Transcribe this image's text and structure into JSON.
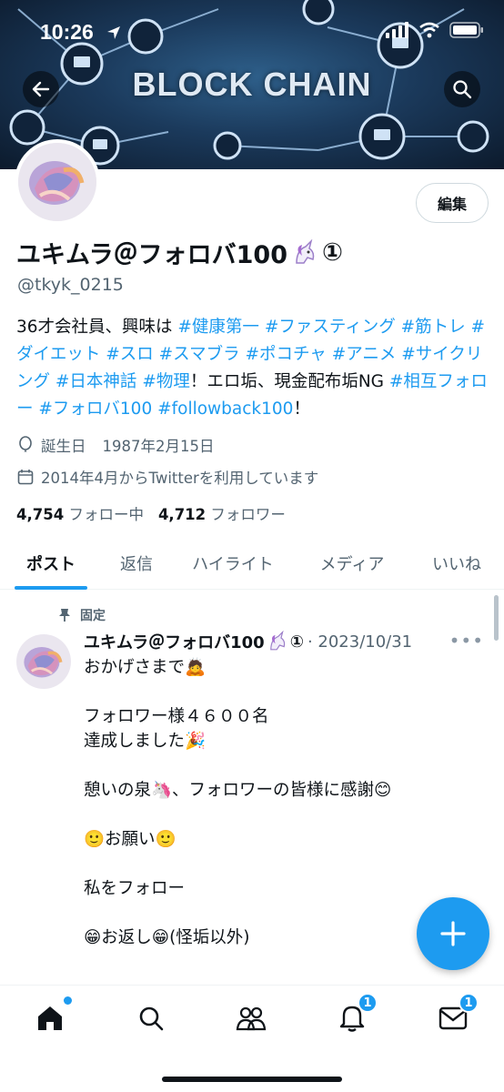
{
  "status_bar": {
    "time": "10:26"
  },
  "banner": {
    "title": "BLOCK CHAIN"
  },
  "profile": {
    "edit_label": "編集",
    "name": "ユキムラ＠フォロバ100",
    "name_suffix": "①",
    "handle": "@tkyk_0215",
    "bio": [
      {
        "t": "36才会社員、興味は ",
        "tag": false
      },
      {
        "t": "#健康第一",
        "tag": true
      },
      {
        "t": " ",
        "tag": false
      },
      {
        "t": "#ファスティング",
        "tag": true
      },
      {
        "t": " ",
        "tag": false
      },
      {
        "t": "#筋トレ",
        "tag": true
      },
      {
        "t": " ",
        "tag": false
      },
      {
        "t": "#ダイエット",
        "tag": true
      },
      {
        "t": " ",
        "tag": false
      },
      {
        "t": "#スロ",
        "tag": true
      },
      {
        "t": " ",
        "tag": false
      },
      {
        "t": "#スマブラ",
        "tag": true
      },
      {
        "t": " ",
        "tag": false
      },
      {
        "t": "#ポコチャ",
        "tag": true
      },
      {
        "t": " ",
        "tag": false
      },
      {
        "t": "#アニメ",
        "tag": true
      },
      {
        "t": " ",
        "tag": false
      },
      {
        "t": "#サイクリング",
        "tag": true
      },
      {
        "t": " ",
        "tag": false
      },
      {
        "t": "#日本神話",
        "tag": true
      },
      {
        "t": " ",
        "tag": false
      },
      {
        "t": "#物理",
        "tag": true
      },
      {
        "t": "！エロ垢、現金配布垢NG ",
        "tag": false
      },
      {
        "t": "#相互フォロー",
        "tag": true
      },
      {
        "t": " ",
        "tag": false
      },
      {
        "t": "#フォロバ100",
        "tag": true
      },
      {
        "t": " ",
        "tag": false
      },
      {
        "t": "#followback100",
        "tag": true
      },
      {
        "t": "！",
        "tag": false
      }
    ],
    "birthday_label": "誕生日",
    "birthday": "1987年2月15日",
    "joined": "2014年4月からTwitterを利用しています",
    "following_count": "4,754",
    "following_label": "フォロー中",
    "followers_count": "4,712",
    "followers_label": "フォロワー"
  },
  "tabs": [
    "ポスト",
    "返信",
    "ハイライト",
    "メディア",
    "いいね"
  ],
  "post": {
    "pinned_label": "固定",
    "author": "ユキムラ＠フォロバ100",
    "author_suffix": "①",
    "date": "· 2023/10/31",
    "lines": [
      "おかげさまで🙇",
      "",
      "フォロワー様４６００名",
      "達成しました🎉",
      "",
      "憩いの泉🦄、フォロワーの皆様に感謝😊",
      "",
      "🙂お願い🙂",
      "",
      "私をフォロー",
      "",
      "😁お返し😁(怪垢以外)"
    ]
  },
  "nav": {
    "notifications_badge": "1",
    "messages_badge": "1"
  },
  "colors": {
    "accent": "#1d9bf0",
    "text": "#0f1419",
    "muted": "#536471"
  }
}
